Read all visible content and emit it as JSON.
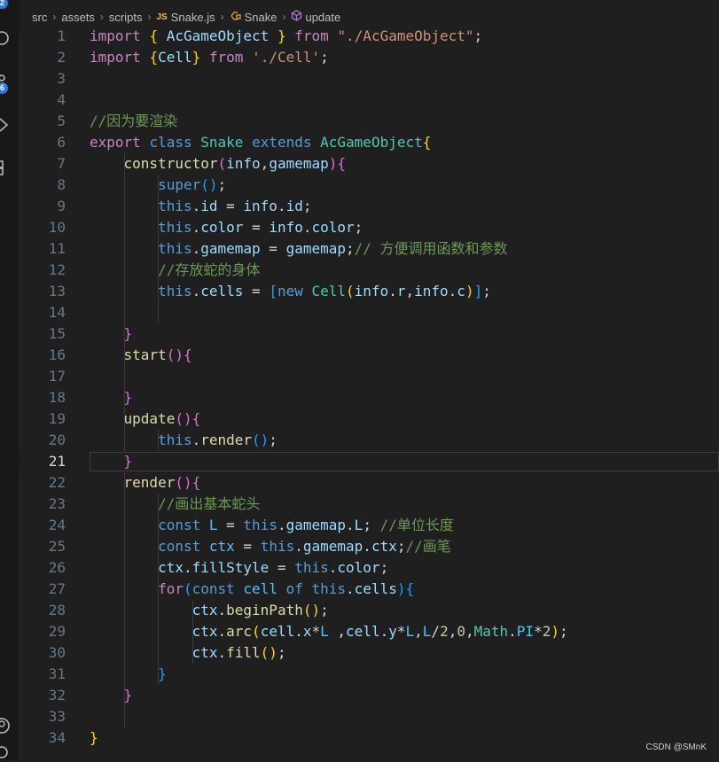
{
  "activity_bar": {
    "badges": [
      "2",
      "6"
    ]
  },
  "breadcrumb": {
    "items": [
      "src",
      "assets",
      "scripts",
      "Snake.js",
      "Snake",
      "update"
    ],
    "js_tag": "JS"
  },
  "editor": {
    "active_line": 21,
    "lines": [
      {
        "n": "1",
        "tokens": [
          [
            "c",
            "import"
          ],
          [
            "p",
            " "
          ],
          [
            "b1",
            "{"
          ],
          [
            "p",
            " "
          ],
          [
            "v",
            "AcGameObject"
          ],
          [
            "p",
            " "
          ],
          [
            "b1",
            "}"
          ],
          [
            "p",
            " "
          ],
          [
            "c",
            "from"
          ],
          [
            "p",
            " "
          ],
          [
            "s",
            "\"./AcGameObject\""
          ],
          [
            "p",
            ";"
          ]
        ]
      },
      {
        "n": "2",
        "tokens": [
          [
            "c",
            "import"
          ],
          [
            "p",
            " "
          ],
          [
            "b1",
            "{"
          ],
          [
            "v",
            "Cell"
          ],
          [
            "b1",
            "}"
          ],
          [
            "p",
            " "
          ],
          [
            "c",
            "from"
          ],
          [
            "p",
            " "
          ],
          [
            "s",
            "'./Cell'"
          ],
          [
            "p",
            ";"
          ]
        ]
      },
      {
        "n": "3",
        "tokens": []
      },
      {
        "n": "4",
        "tokens": []
      },
      {
        "n": "5",
        "tokens": [
          [
            "cm",
            "//因为要渲染"
          ]
        ]
      },
      {
        "n": "6",
        "tokens": [
          [
            "c",
            "export"
          ],
          [
            "p",
            " "
          ],
          [
            "k",
            "class"
          ],
          [
            "p",
            " "
          ],
          [
            "t",
            "Snake"
          ],
          [
            "p",
            " "
          ],
          [
            "k",
            "extends"
          ],
          [
            "p",
            " "
          ],
          [
            "t",
            "AcGameObject"
          ],
          [
            "b1",
            "{"
          ]
        ]
      },
      {
        "n": "7",
        "tokens": [
          [
            "p",
            "    "
          ],
          [
            "f",
            "constructor"
          ],
          [
            "b2",
            "("
          ],
          [
            "v",
            "info"
          ],
          [
            "p",
            ","
          ],
          [
            "v",
            "gamemap"
          ],
          [
            "b2",
            ")"
          ],
          [
            "b2",
            "{"
          ]
        ]
      },
      {
        "n": "8",
        "tokens": [
          [
            "p",
            "        "
          ],
          [
            "k",
            "super"
          ],
          [
            "b3",
            "()"
          ],
          [
            "p",
            ";"
          ]
        ]
      },
      {
        "n": "9",
        "tokens": [
          [
            "p",
            "        "
          ],
          [
            "k",
            "this"
          ],
          [
            "p",
            "."
          ],
          [
            "v",
            "id"
          ],
          [
            "p",
            " = "
          ],
          [
            "v",
            "info"
          ],
          [
            "p",
            "."
          ],
          [
            "v",
            "id"
          ],
          [
            "p",
            ";"
          ]
        ]
      },
      {
        "n": "10",
        "tokens": [
          [
            "p",
            "        "
          ],
          [
            "k",
            "this"
          ],
          [
            "p",
            "."
          ],
          [
            "v",
            "color"
          ],
          [
            "p",
            " = "
          ],
          [
            "v",
            "info"
          ],
          [
            "p",
            "."
          ],
          [
            "v",
            "color"
          ],
          [
            "p",
            ";"
          ]
        ]
      },
      {
        "n": "11",
        "tokens": [
          [
            "p",
            "        "
          ],
          [
            "k",
            "this"
          ],
          [
            "p",
            "."
          ],
          [
            "v",
            "gamemap"
          ],
          [
            "p",
            " = "
          ],
          [
            "v",
            "gamemap"
          ],
          [
            "p",
            ";"
          ],
          [
            "cm",
            "// 方便调用函数和参数"
          ]
        ]
      },
      {
        "n": "12",
        "tokens": [
          [
            "p",
            "        "
          ],
          [
            "cm",
            "//存放蛇的身体"
          ]
        ]
      },
      {
        "n": "13",
        "tokens": [
          [
            "p",
            "        "
          ],
          [
            "k",
            "this"
          ],
          [
            "p",
            "."
          ],
          [
            "v",
            "cells"
          ],
          [
            "p",
            " = "
          ],
          [
            "b3",
            "["
          ],
          [
            "k",
            "new"
          ],
          [
            "p",
            " "
          ],
          [
            "t",
            "Cell"
          ],
          [
            "b1",
            "("
          ],
          [
            "v",
            "info"
          ],
          [
            "p",
            "."
          ],
          [
            "v",
            "r"
          ],
          [
            "p",
            ","
          ],
          [
            "v",
            "info"
          ],
          [
            "p",
            "."
          ],
          [
            "v",
            "c"
          ],
          [
            "b1",
            ")"
          ],
          [
            "b3",
            "]"
          ],
          [
            "p",
            ";"
          ]
        ]
      },
      {
        "n": "14",
        "tokens": []
      },
      {
        "n": "15",
        "tokens": [
          [
            "p",
            "    "
          ],
          [
            "b2",
            "}"
          ]
        ]
      },
      {
        "n": "16",
        "tokens": [
          [
            "p",
            "    "
          ],
          [
            "f",
            "start"
          ],
          [
            "b2",
            "()"
          ],
          [
            "b2",
            "{"
          ]
        ]
      },
      {
        "n": "17",
        "tokens": []
      },
      {
        "n": "18",
        "tokens": [
          [
            "p",
            "    "
          ],
          [
            "b2",
            "}"
          ]
        ]
      },
      {
        "n": "19",
        "tokens": [
          [
            "p",
            "    "
          ],
          [
            "f",
            "update"
          ],
          [
            "b2",
            "()"
          ],
          [
            "b2",
            "{"
          ]
        ]
      },
      {
        "n": "20",
        "tokens": [
          [
            "p",
            "        "
          ],
          [
            "k",
            "this"
          ],
          [
            "p",
            "."
          ],
          [
            "f",
            "render"
          ],
          [
            "b3",
            "()"
          ],
          [
            "p",
            ";"
          ]
        ]
      },
      {
        "n": "21",
        "tokens": [
          [
            "p",
            "    "
          ],
          [
            "b2",
            "}"
          ]
        ]
      },
      {
        "n": "22",
        "tokens": [
          [
            "p",
            "    "
          ],
          [
            "f",
            "render"
          ],
          [
            "b2",
            "()"
          ],
          [
            "b2",
            "{"
          ]
        ]
      },
      {
        "n": "23",
        "tokens": [
          [
            "p",
            "        "
          ],
          [
            "cm",
            "//画出基本蛇头"
          ]
        ]
      },
      {
        "n": "24",
        "tokens": [
          [
            "p",
            "        "
          ],
          [
            "k",
            "const"
          ],
          [
            "p",
            " "
          ],
          [
            "cn",
            "L"
          ],
          [
            "p",
            " = "
          ],
          [
            "k",
            "this"
          ],
          [
            "p",
            "."
          ],
          [
            "v",
            "gamemap"
          ],
          [
            "p",
            "."
          ],
          [
            "v",
            "L"
          ],
          [
            "p",
            "; "
          ],
          [
            "cm",
            "//单位长度"
          ]
        ]
      },
      {
        "n": "25",
        "tokens": [
          [
            "p",
            "        "
          ],
          [
            "k",
            "const"
          ],
          [
            "p",
            " "
          ],
          [
            "cn",
            "ctx"
          ],
          [
            "p",
            " = "
          ],
          [
            "k",
            "this"
          ],
          [
            "p",
            "."
          ],
          [
            "v",
            "gamemap"
          ],
          [
            "p",
            "."
          ],
          [
            "v",
            "ctx"
          ],
          [
            "p",
            ";"
          ],
          [
            "cm",
            "//画笔"
          ]
        ]
      },
      {
        "n": "26",
        "tokens": [
          [
            "p",
            "        "
          ],
          [
            "v",
            "ctx"
          ],
          [
            "p",
            "."
          ],
          [
            "v",
            "fillStyle"
          ],
          [
            "p",
            " = "
          ],
          [
            "k",
            "this"
          ],
          [
            "p",
            "."
          ],
          [
            "v",
            "color"
          ],
          [
            "p",
            ";"
          ]
        ]
      },
      {
        "n": "27",
        "tokens": [
          [
            "p",
            "        "
          ],
          [
            "c",
            "for"
          ],
          [
            "b3",
            "("
          ],
          [
            "k",
            "const"
          ],
          [
            "p",
            " "
          ],
          [
            "cn",
            "cell"
          ],
          [
            "p",
            " "
          ],
          [
            "k",
            "of"
          ],
          [
            "p",
            " "
          ],
          [
            "k",
            "this"
          ],
          [
            "p",
            "."
          ],
          [
            "v",
            "cells"
          ],
          [
            "b3",
            ")"
          ],
          [
            "b3",
            "{"
          ]
        ]
      },
      {
        "n": "28",
        "tokens": [
          [
            "p",
            "            "
          ],
          [
            "v",
            "ctx"
          ],
          [
            "p",
            "."
          ],
          [
            "f",
            "beginPath"
          ],
          [
            "b1",
            "()"
          ],
          [
            "p",
            ";"
          ]
        ]
      },
      {
        "n": "29",
        "tokens": [
          [
            "p",
            "            "
          ],
          [
            "v",
            "ctx"
          ],
          [
            "p",
            "."
          ],
          [
            "f",
            "arc"
          ],
          [
            "b1",
            "("
          ],
          [
            "v",
            "cell"
          ],
          [
            "p",
            "."
          ],
          [
            "v",
            "x"
          ],
          [
            "p",
            "*"
          ],
          [
            "cn",
            "L"
          ],
          [
            "p",
            " ,"
          ],
          [
            "v",
            "cell"
          ],
          [
            "p",
            "."
          ],
          [
            "v",
            "y"
          ],
          [
            "p",
            "*"
          ],
          [
            "cn",
            "L"
          ],
          [
            "p",
            ","
          ],
          [
            "cn",
            "L"
          ],
          [
            "p",
            "/"
          ],
          [
            "n",
            "2"
          ],
          [
            "p",
            ","
          ],
          [
            "n",
            "0"
          ],
          [
            "p",
            ","
          ],
          [
            "t",
            "Math"
          ],
          [
            "p",
            "."
          ],
          [
            "cn",
            "PI"
          ],
          [
            "p",
            "*"
          ],
          [
            "n",
            "2"
          ],
          [
            "b1",
            ")"
          ],
          [
            "p",
            ";"
          ]
        ]
      },
      {
        "n": "30",
        "tokens": [
          [
            "p",
            "            "
          ],
          [
            "v",
            "ctx"
          ],
          [
            "p",
            "."
          ],
          [
            "f",
            "fill"
          ],
          [
            "b1",
            "()"
          ],
          [
            "p",
            ";"
          ]
        ]
      },
      {
        "n": "31",
        "tokens": [
          [
            "p",
            "        "
          ],
          [
            "b3",
            "}"
          ]
        ]
      },
      {
        "n": "32",
        "tokens": [
          [
            "p",
            "    "
          ],
          [
            "b2",
            "}"
          ]
        ]
      },
      {
        "n": "33",
        "tokens": []
      },
      {
        "n": "34",
        "tokens": [
          [
            "b1",
            "}"
          ]
        ]
      }
    ]
  },
  "watermark": "CSDN @SMnK"
}
